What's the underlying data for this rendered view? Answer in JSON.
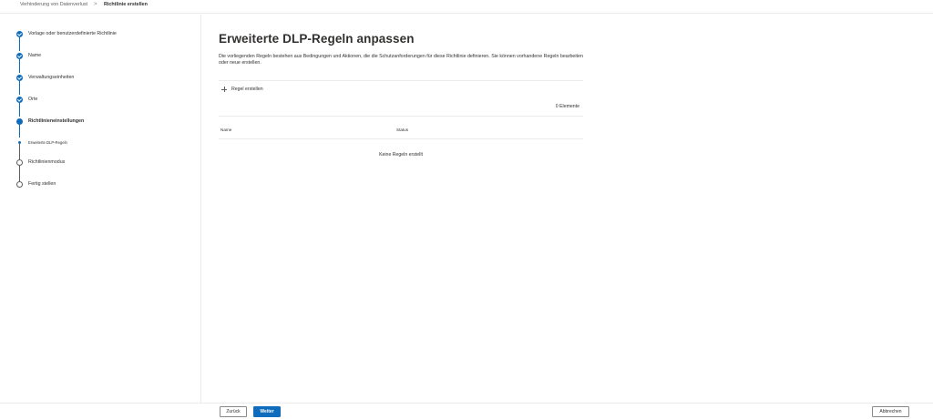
{
  "breadcrumb": {
    "parent": "Verhinderung von Datenverlust",
    "separator": ">",
    "current": "Richtlinie erstellen"
  },
  "steps": [
    {
      "label": "Vorlage oder benutzerdefinierte Richtlinie",
      "state": "done"
    },
    {
      "label": "Name",
      "state": "done"
    },
    {
      "label": "Verwaltungseinheiten",
      "state": "done"
    },
    {
      "label": "Orte",
      "state": "done"
    },
    {
      "label": "Richtlinieneinstellungen",
      "state": "current"
    },
    {
      "label": "Erweiterte DLP-Regeln",
      "state": "current-substep"
    },
    {
      "label": "Richtlinienmodus",
      "state": "pending"
    },
    {
      "label": "Fertig stellen",
      "state": "pending"
    }
  ],
  "main": {
    "title": "Erweiterte DLP-Regeln anpassen",
    "description": "Die vorliegenden Regeln bestehen aus Bedingungen und Aktionen, die die Schutzanforderungen für diese Richtlinie definieren. Sie können vorhandene Regeln bearbeiten oder neue erstellen.",
    "create_rule_label": "Regel erstellen",
    "item_count": "0 Elemente",
    "columns": {
      "name": "Name",
      "status": "Status"
    },
    "empty_message": "Keine Regeln erstellt"
  },
  "footer": {
    "back_label": "Zurück",
    "next_label": "Weiter",
    "cancel_label": "Abbrechen"
  },
  "colors": {
    "accent": "#0f6cbd",
    "text": "#323130",
    "divider": "#edebe9"
  }
}
